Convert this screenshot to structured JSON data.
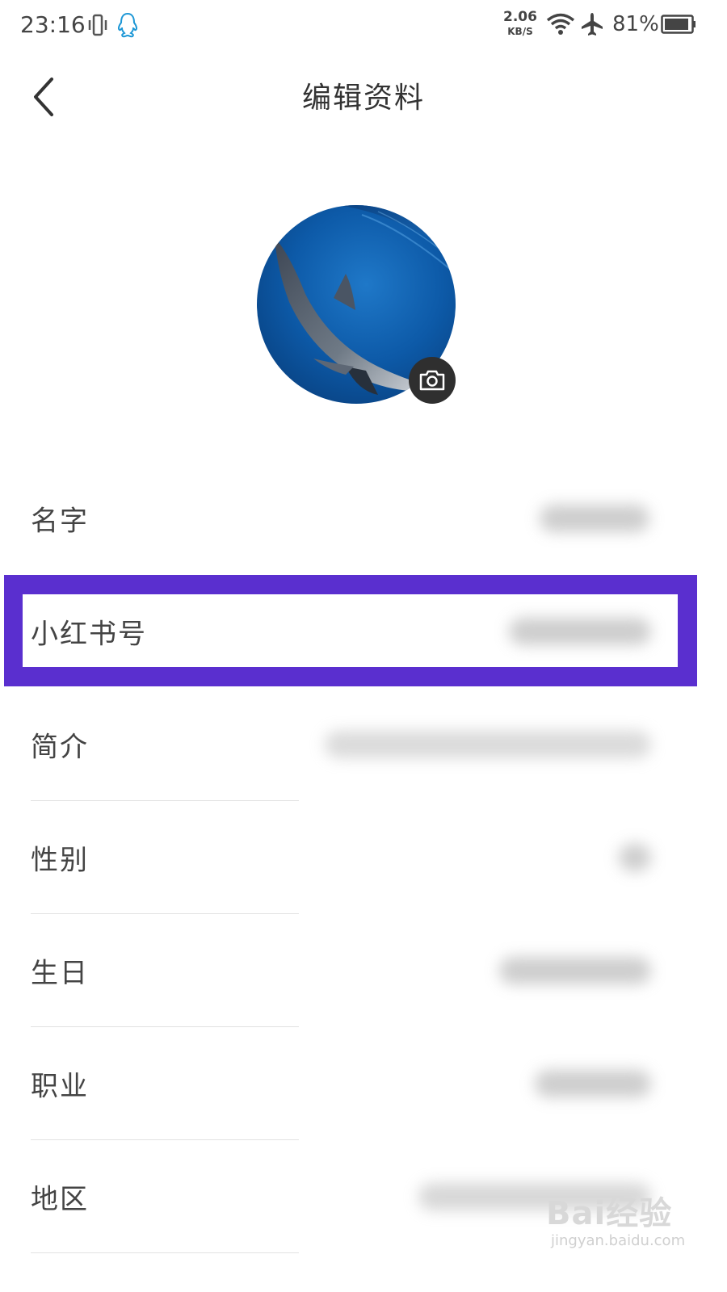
{
  "status_bar": {
    "time": "23:16",
    "net_speed_value": "2.06",
    "net_speed_unit": "KB/S",
    "battery_percent": "81%",
    "icons": [
      "vibrate-icon",
      "qq-icon",
      "wifi-icon",
      "airplane-icon",
      "battery-icon"
    ]
  },
  "header": {
    "title": "编辑资料",
    "back_icon": "chevron-left-icon"
  },
  "avatar": {
    "camera_icon": "camera-icon"
  },
  "fields": [
    {
      "label": "名字"
    },
    {
      "label": "小红书号"
    },
    {
      "label": "简介"
    },
    {
      "label": "性别"
    },
    {
      "label": "生日"
    },
    {
      "label": "职业"
    },
    {
      "label": "地区"
    }
  ],
  "highlight_color": "#5a2fcf",
  "watermark": {
    "main": "Bai经验",
    "sub": "jingyan.baidu.com"
  }
}
